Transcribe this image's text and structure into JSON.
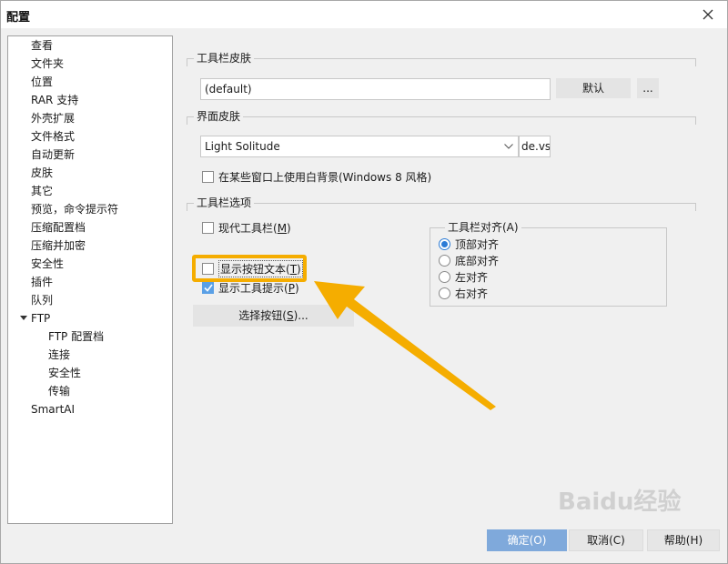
{
  "window": {
    "title": "配置"
  },
  "nav": {
    "items": [
      {
        "label": "查看",
        "indent": 0
      },
      {
        "label": "文件夹",
        "indent": 0
      },
      {
        "label": "位置",
        "indent": 0
      },
      {
        "label": "RAR 支持",
        "indent": 0
      },
      {
        "label": "外壳扩展",
        "indent": 0
      },
      {
        "label": "文件格式",
        "indent": 0
      },
      {
        "label": "自动更新",
        "indent": 0
      },
      {
        "label": "皮肤",
        "indent": 0
      },
      {
        "label": "其它",
        "indent": 0
      },
      {
        "label": "预览，命令提示符",
        "indent": 0
      },
      {
        "label": "压缩配置档",
        "indent": 0
      },
      {
        "label": "压缩并加密",
        "indent": 0
      },
      {
        "label": "安全性",
        "indent": 0
      },
      {
        "label": "插件",
        "indent": 0
      },
      {
        "label": "队列",
        "indent": 0
      },
      {
        "label": "FTP",
        "indent": 0,
        "expanded": true
      },
      {
        "label": "FTP 配置档",
        "indent": 1
      },
      {
        "label": "连接",
        "indent": 1
      },
      {
        "label": "安全性",
        "indent": 1
      },
      {
        "label": "传输",
        "indent": 1
      },
      {
        "label": "SmartAI",
        "indent": 0
      }
    ]
  },
  "toolbar_skin": {
    "header": "工具栏皮肤",
    "value": "(default)",
    "default_button": "默认",
    "browse_button": "..."
  },
  "ui_skin": {
    "header": "界面皮肤",
    "selected": "Light Solitude",
    "file_suffix": "de.vsf",
    "white_bg_checkbox": "在某些窗口上使用白背景(Windows 8 风格)",
    "white_bg_checked": false
  },
  "toolbar_options": {
    "header": "工具栏选项",
    "modern_toolbar": {
      "text": "现代工具栏(",
      "key": "M",
      "tail": ")",
      "checked": false
    },
    "show_button_text": {
      "text": "显示按钮文本(",
      "key": "T",
      "tail": ")",
      "checked": false
    },
    "show_tooltips": {
      "text": "显示工具提示(",
      "key": "P",
      "tail": ")",
      "checked": true
    },
    "select_buttons": {
      "text": "选择按钮(",
      "key": "S",
      "tail": ")..."
    }
  },
  "alignment": {
    "header": "工具栏对齐(A)",
    "options": [
      {
        "label": "顶部对齐",
        "checked": true
      },
      {
        "label": "底部对齐",
        "checked": false
      },
      {
        "label": "左对齐",
        "checked": false
      },
      {
        "label": "右对齐",
        "checked": false
      }
    ]
  },
  "footer": {
    "ok": "确定(O)",
    "cancel": "取消(C)",
    "help": "帮助(H)"
  },
  "watermark": "Baidu经验",
  "colors": {
    "highlight": "#f5ad00",
    "arrow": "#f5ad00",
    "primary_button": "#7fa9db",
    "radio_selected": "#2b7bd6"
  }
}
